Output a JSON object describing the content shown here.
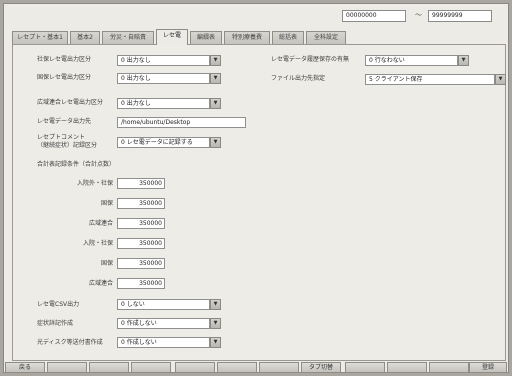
{
  "range": {
    "from": "00000000",
    "separator": "〜",
    "to": "99999999"
  },
  "tabs": [
    {
      "label": "レセプト・基本1",
      "active": false
    },
    {
      "label": "基本2",
      "active": false
    },
    {
      "label": "労災・自賠責",
      "active": false
    },
    {
      "label": "レセ電",
      "active": true
    },
    {
      "label": "編綴表",
      "active": false
    },
    {
      "label": "特別療養費",
      "active": false
    },
    {
      "label": "総括表",
      "active": false
    },
    {
      "label": "全科設定",
      "active": false
    }
  ],
  "form": {
    "shaho_label": "社保レセ電出力区分",
    "shaho_value": "0 出力なし",
    "kokuho_label": "国保レセ電出力区分",
    "kokuho_value": "0 出力なし",
    "kouiki_label": "広域連合レセ電出力区分",
    "kouiki_value": "0 出力なし",
    "output_dest_label": "レセ電データ出力先",
    "output_dest_value": "/home/ubuntu/Desktop",
    "comment_label_1": "レセプトコメント",
    "comment_label_2": "（継続症状）記録区分",
    "comment_value": "0 レセ電データに記録する",
    "cmt_note": "",
    "section_title": "合計表記録条件（合計点数）",
    "inpatient_label": "入院外・社保",
    "inpatient_value": "350000",
    "kokuho1_label": "国保",
    "kokuho1_value": "350000",
    "kouiki1_label": "広域連合",
    "kouiki1_value": "350000",
    "nyuin_label": "入院・社保",
    "nyuin_value": "350000",
    "kokuho2_label": "国保",
    "kokuho2_value": "350000",
    "kouiki2_label": "広域連合",
    "kouiki2_value": "350000",
    "csv_label": "レセ電CSV出力",
    "csv_value": "0 しない",
    "grant_label": "症状詳記作成",
    "grant_value": "0 作成しない",
    "disk_label": "光ディスク等送付書作成",
    "disk_value": "0 作成しない",
    "right_1_label": "レセ電データ履歴保存の有無",
    "right_1_value": "0 行なわない",
    "right_2_label": "ファイル出力先指定",
    "right_2_value": "5 クライアント保存"
  },
  "footer": {
    "back": "戻る",
    "tab_switch": "タブ切替",
    "register": "登録"
  }
}
